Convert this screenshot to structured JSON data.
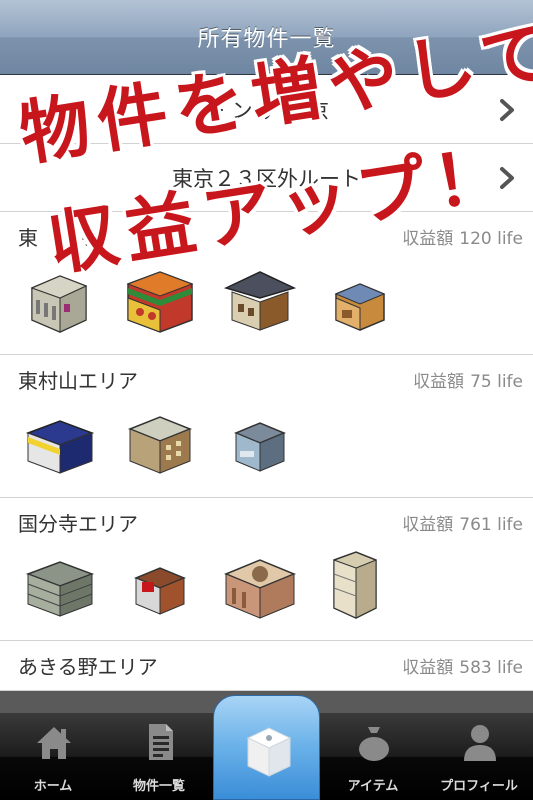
{
  "navbar": {
    "title": "所有物件一覧"
  },
  "routes": [
    {
      "label": "ー ン テ 東京"
    },
    {
      "label": "東京２３区外ルート"
    }
  ],
  "income_label": "収益額",
  "areas": [
    {
      "name": "東　　リ",
      "income": "120 life",
      "buildings": [
        "office-building",
        "temple-shop",
        "japanese-house",
        "small-shop"
      ]
    },
    {
      "name": "東村山エリア",
      "income": "75 life",
      "buildings": [
        "convenience-store",
        "apartment",
        "small-office"
      ]
    },
    {
      "name": "国分寺エリア",
      "income": "761 life",
      "buildings": [
        "office-block",
        "red-shop",
        "ruins",
        "tower"
      ]
    },
    {
      "name": "あきる野エリア",
      "income": "583 life"
    }
  ],
  "banner": {
    "line1": "物件を増やして",
    "line2": "収益アップ！"
  },
  "tabs": [
    {
      "label": "ホーム",
      "icon": "home-icon"
    },
    {
      "label": "物件一覧",
      "icon": "document-icon"
    },
    {
      "label": "",
      "icon": "dice-icon"
    },
    {
      "label": "アイテム",
      "icon": "bag-icon"
    },
    {
      "label": "プロフィール",
      "icon": "person-icon"
    }
  ],
  "colors": {
    "banner": "#c8161d",
    "navbar": "#8fa4bd",
    "center_tab": "#3a8dd8"
  }
}
